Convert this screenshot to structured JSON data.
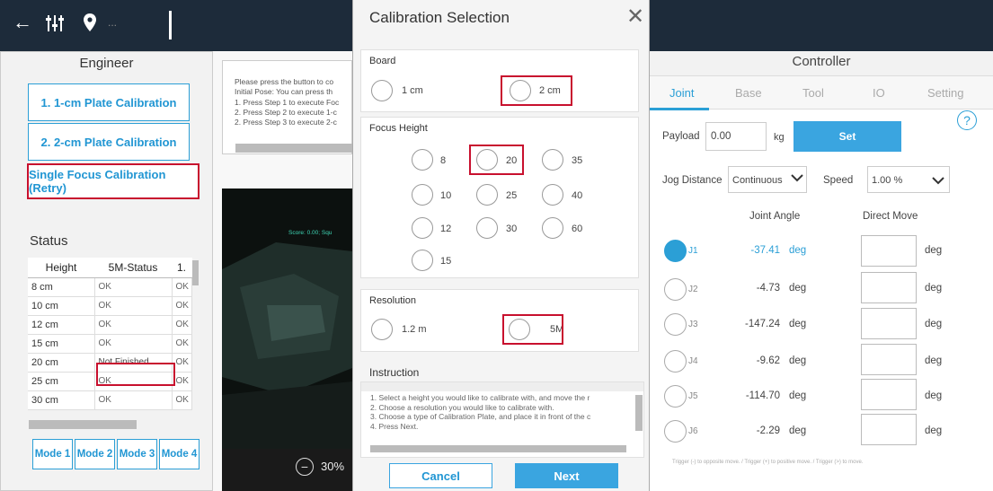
{
  "topbar": {
    "icons": [
      "back-arrow-icon",
      "sliders-icon",
      "location-pin-icon",
      "more-icon"
    ],
    "more_label": "..."
  },
  "left": {
    "title": "Engineer",
    "buttons": [
      "1. 1-cm Plate Calibration",
      "2. 2-cm Plate Calibration",
      "Single Focus Calibration (Retry)"
    ],
    "status_title": "Status",
    "columns": [
      "Height",
      "5M-Status",
      "1."
    ],
    "rows": [
      {
        "h": "8 cm",
        "s5": "OK",
        "s1": "OK"
      },
      {
        "h": "10 cm",
        "s5": "OK",
        "s1": "OK"
      },
      {
        "h": "12 cm",
        "s5": "OK",
        "s1": "OK"
      },
      {
        "h": "15 cm",
        "s5": "OK",
        "s1": "OK"
      },
      {
        "h": "20 cm",
        "s5": "Not Finished",
        "s1": "OK"
      },
      {
        "h": "25 cm",
        "s5": "OK",
        "s1": "OK"
      },
      {
        "h": "30 cm",
        "s5": "OK",
        "s1": "OK"
      }
    ],
    "modes": [
      "Mode 1",
      "Mode 2",
      "Mode 3",
      "Mode 4"
    ]
  },
  "middle": {
    "message": [
      "Please press the button to co",
      "Initial Pose: You can press th",
      "1. Press Step 1 to execute Foc",
      "2. Press Step 2 to execute 1-c",
      "2. Press Step 3 to execute 2-c"
    ],
    "camera_overlay": "Score: 0.00; Squ",
    "zoom": "30%"
  },
  "modal": {
    "title": "Calibration Selection",
    "board": {
      "label": "Board",
      "options": [
        "1 cm",
        "2 cm"
      ]
    },
    "focus": {
      "label": "Focus Height",
      "options": [
        "8",
        "20",
        "35",
        "10",
        "25",
        "40",
        "12",
        "30",
        "60",
        "15"
      ]
    },
    "resolution": {
      "label": "Resolution",
      "options": [
        "1.2 m",
        "5M"
      ]
    },
    "instruction": {
      "label": "Instruction",
      "lines": [
        "1. Select a height you would like to calibrate with, and move the r",
        "2. Choose a resolution you would like to calibrate with.",
        "3. Choose a type of Calibration Plate, and place it in front of the c",
        "4. Press Next."
      ]
    },
    "cancel": "Cancel",
    "next": "Next"
  },
  "controller": {
    "title": "Controller",
    "tabs": [
      "Joint",
      "Base",
      "Tool",
      "IO",
      "Setting"
    ],
    "payload_label": "Payload",
    "payload_value": "0.00",
    "payload_unit": "kg",
    "set_label": "Set",
    "jog_label": "Jog Distance",
    "jog_value": "Continuous",
    "speed_label": "Speed",
    "speed_value": "1.00 %",
    "col_joint": "Joint Angle",
    "col_direct": "Direct Move",
    "joints": [
      {
        "name": "J1",
        "value": "-37.41",
        "unit": "deg",
        "dunit": "deg"
      },
      {
        "name": "J2",
        "value": "-4.73",
        "unit": "deg",
        "dunit": "deg"
      },
      {
        "name": "J3",
        "value": "-147.24",
        "unit": "deg",
        "dunit": "deg"
      },
      {
        "name": "J4",
        "value": "-9.62",
        "unit": "deg",
        "dunit": "deg"
      },
      {
        "name": "J5",
        "value": "-114.70",
        "unit": "deg",
        "dunit": "deg"
      },
      {
        "name": "J6",
        "value": "-2.29",
        "unit": "deg",
        "dunit": "deg"
      }
    ],
    "footer": "Trigger (-) to opposite move. / Trigger (+) to positive move. / Trigger (>) to move."
  },
  "colors": {
    "accent": "#2196d3",
    "highlight": "#c8102e",
    "topbar": "#1d2b3a",
    "next": "#3aa5e0"
  }
}
